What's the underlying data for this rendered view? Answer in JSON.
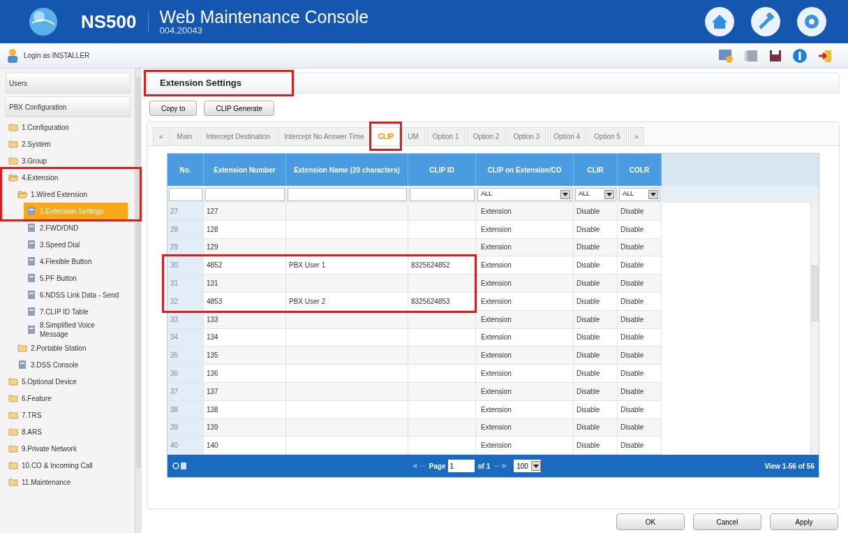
{
  "header": {
    "product": "NS500",
    "title": "Web Maintenance Console",
    "version": "004.20043"
  },
  "toolbar": {
    "login": "Login as INSTALLER"
  },
  "sidebar": {
    "panels": [
      "Users",
      "PBX Configuration"
    ],
    "tree": [
      {
        "label": "1.Configuration",
        "kind": "folder",
        "selected": false
      },
      {
        "label": "2.System",
        "kind": "folder",
        "selected": false
      },
      {
        "label": "3.Group",
        "kind": "folder",
        "selected": false
      },
      {
        "label": "4.Extension",
        "kind": "folder-open",
        "selected": false,
        "children": [
          {
            "label": "1.Wired Extension",
            "kind": "folder-open",
            "selected": false,
            "children": [
              {
                "label": "1.Extension Settings",
                "kind": "page",
                "selected": true
              },
              {
                "label": "2.FWD/DND",
                "kind": "page",
                "selected": false
              },
              {
                "label": "3.Speed Dial",
                "kind": "page",
                "selected": false
              },
              {
                "label": "4.Flexible Button",
                "kind": "page",
                "selected": false
              },
              {
                "label": "5.PF Button",
                "kind": "page",
                "selected": false
              },
              {
                "label": "6.NDSS Link Data - Send",
                "kind": "page",
                "selected": false
              },
              {
                "label": "7.CLIP ID Table",
                "kind": "page",
                "selected": false
              },
              {
                "label": "8.Simplified Voice Message",
                "kind": "page",
                "selected": false
              }
            ]
          },
          {
            "label": "2.Portable Station",
            "kind": "folder",
            "selected": false
          },
          {
            "label": "3.DSS Console",
            "kind": "page",
            "selected": false
          }
        ]
      },
      {
        "label": "5.Optional Device",
        "kind": "folder",
        "selected": false
      },
      {
        "label": "6.Feature",
        "kind": "folder",
        "selected": false
      },
      {
        "label": "7.TRS",
        "kind": "folder",
        "selected": false
      },
      {
        "label": "8.ARS",
        "kind": "folder",
        "selected": false
      },
      {
        "label": "9.Private Network",
        "kind": "folder",
        "selected": false
      },
      {
        "label": "10.CO & Incoming Call",
        "kind": "folder",
        "selected": false
      },
      {
        "label": "11.Maintenance",
        "kind": "folder",
        "selected": false
      }
    ]
  },
  "page_title": "Extension Settings",
  "action_buttons": [
    "Copy to",
    "CLIP Generate"
  ],
  "tabs": [
    {
      "label": "«",
      "selected": false
    },
    {
      "label": "Main",
      "selected": false
    },
    {
      "label": "Intercept Destination",
      "selected": false
    },
    {
      "label": "Intercept No Answer Time",
      "selected": false
    },
    {
      "label": "CLIP",
      "selected": true
    },
    {
      "label": "UM",
      "selected": false
    },
    {
      "label": "Option 1",
      "selected": false
    },
    {
      "label": "Option 2",
      "selected": false
    },
    {
      "label": "Option 3",
      "selected": false
    },
    {
      "label": "Option 4",
      "selected": false
    },
    {
      "label": "Option 5",
      "selected": false
    },
    {
      "label": "»",
      "selected": false
    }
  ],
  "table": {
    "columns": [
      "No.",
      "Extension Number",
      "Extension Name (20 characters)",
      "CLIP ID",
      "CLIP on Extension/CO",
      "CLIR",
      "COLR"
    ],
    "filters": [
      {
        "kind": "field"
      },
      {
        "kind": "field"
      },
      {
        "kind": "field"
      },
      {
        "kind": "field"
      },
      {
        "kind": "dropdown",
        "value": "ALL"
      },
      {
        "kind": "dropdown",
        "value": "ALL"
      },
      {
        "kind": "dropdown",
        "value": "ALL"
      }
    ],
    "rows": [
      [
        "27",
        "127",
        "",
        "",
        "Extension",
        "Disable",
        "Disable"
      ],
      [
        "28",
        "128",
        "",
        "",
        "Extension",
        "Disable",
        "Disable"
      ],
      [
        "29",
        "129",
        "",
        "",
        "Extension",
        "Disable",
        "Disable"
      ],
      [
        "30",
        "4852",
        "PBX User 1",
        "8325624852",
        "Extension",
        "Disable",
        "Disable"
      ],
      [
        "31",
        "131",
        "",
        "",
        "Extension",
        "Disable",
        "Disable"
      ],
      [
        "32",
        "4853",
        "PBX User 2",
        "8325624853",
        "Extension",
        "Disable",
        "Disable"
      ],
      [
        "33",
        "133",
        "",
        "",
        "Extension",
        "Disable",
        "Disable"
      ],
      [
        "34",
        "134",
        "",
        "",
        "Extension",
        "Disable",
        "Disable"
      ],
      [
        "35",
        "135",
        "",
        "",
        "Extension",
        "Disable",
        "Disable"
      ],
      [
        "36",
        "136",
        "",
        "",
        "Extension",
        "Disable",
        "Disable"
      ],
      [
        "37",
        "137",
        "",
        "",
        "Extension",
        "Disable",
        "Disable"
      ],
      [
        "38",
        "138",
        "",
        "",
        "Extension",
        "Disable",
        "Disable"
      ],
      [
        "39",
        "139",
        "",
        "",
        "Extension",
        "Disable",
        "Disable"
      ],
      [
        "40",
        "140",
        "",
        "",
        "Extension",
        "Disable",
        "Disable"
      ]
    ]
  },
  "pager": {
    "page_label": "Page",
    "page": "1",
    "of": "of 1",
    "page_size": "100",
    "summary": "View 1-56 of 56"
  },
  "footer_buttons": [
    "OK",
    "Cancel",
    "Apply"
  ]
}
